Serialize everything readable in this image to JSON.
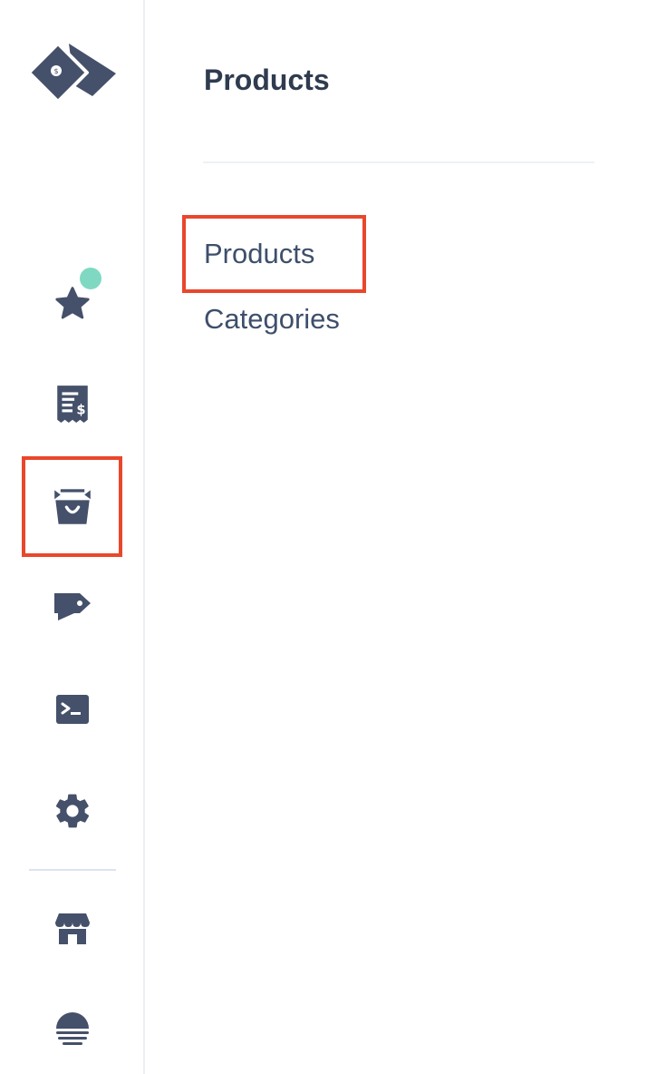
{
  "main": {
    "title": "Products",
    "subnav": [
      {
        "label": "Products"
      },
      {
        "label": "Categories"
      }
    ]
  },
  "sidebar": {
    "items": [
      {
        "icon": "star-icon"
      },
      {
        "icon": "receipt-dollar-icon"
      },
      {
        "icon": "shopping-bag-icon"
      },
      {
        "icon": "tag-icon"
      },
      {
        "icon": "terminal-icon"
      },
      {
        "icon": "gear-icon"
      },
      {
        "icon": "storefront-icon"
      },
      {
        "icon": "sunset-icon"
      }
    ]
  },
  "colors": {
    "icon": "#45506a",
    "highlight": "#e9472c",
    "badge": "#7fd9c2",
    "text": "#3e4f6b"
  }
}
